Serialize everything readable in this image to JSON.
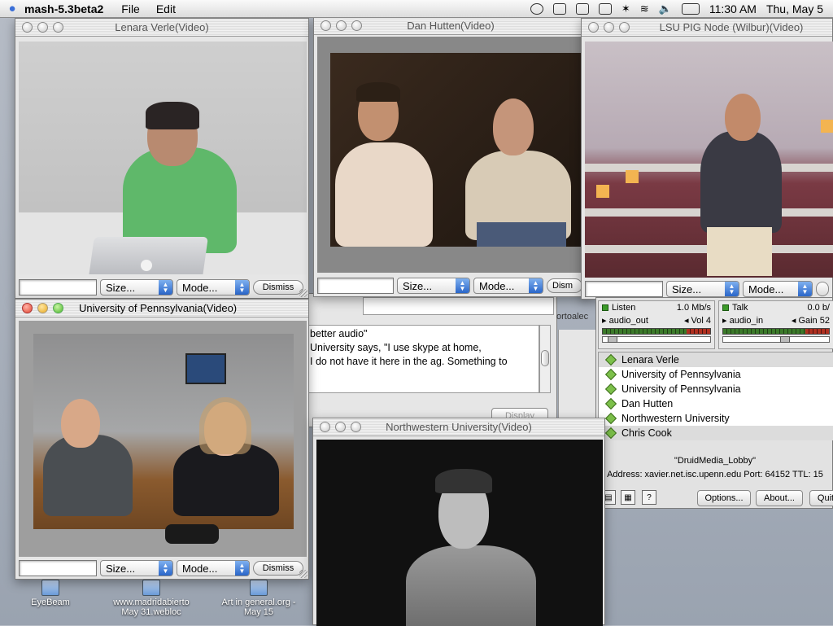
{
  "menubar": {
    "app_name": "mash-5.3beta2",
    "menus": [
      "File",
      "Edit"
    ],
    "clock": "11:30 AM",
    "date": "Thu, May 5"
  },
  "windows": {
    "lenara": {
      "title": "Lenara Verle(Video)",
      "size_label": "Size...",
      "mode_label": "Mode...",
      "dismiss_label": "Dismiss"
    },
    "dan": {
      "title": "Dan Hutten(Video)",
      "size_label": "Size...",
      "mode_label": "Mode...",
      "dismiss_label": "Dism"
    },
    "lsu": {
      "title": "LSU PIG Node (Wilbur)(Video)",
      "size_label": "Size...",
      "mode_label": "Mode..."
    },
    "upenn": {
      "title": "University of Pennsylvania(Video)",
      "size_label": "Size...",
      "mode_label": "Mode...",
      "dismiss_label": "Dismiss"
    },
    "northwestern": {
      "title": "Northwestern University(Video)"
    }
  },
  "chat": {
    "lines": [
      "better audio\"",
      "University says, \"I use skype at home,",
      "I do not have it here in the ag.  Something to"
    ],
    "display_label": "Display",
    "partial_text": "ortoalec"
  },
  "audio": {
    "listen_label": "Listen",
    "listen_rate": "1.0 Mb/s",
    "audio_out_label": "audio_out",
    "vol_label": "Vol",
    "vol_value": "4",
    "talk_label": "Talk",
    "talk_rate": "0.0 b/",
    "audio_in_label": "audio_in",
    "gain_label": "Gain",
    "gain_value": "52"
  },
  "participants": [
    "Lenara Verle",
    "University of Pennsylvania",
    "University of Pennsylvania",
    "Dan Hutten",
    "Northwestern University",
    "Chris Cook"
  ],
  "session": {
    "name": "\"DruidMedia_Lobby\"",
    "address": "Address: xavier.net.isc.upenn.edu Port: 64152 TTL: 15",
    "options_label": "Options...",
    "about_label": "About...",
    "quit_label": "Quit"
  },
  "desktop_icons": [
    {
      "label_1": "EyeBeam",
      "label_2": ""
    },
    {
      "label_1": "www.madridabierto",
      "label_2": "May 31.webloc"
    },
    {
      "label_1": "Art in general.org -",
      "label_2": "May 15"
    }
  ]
}
